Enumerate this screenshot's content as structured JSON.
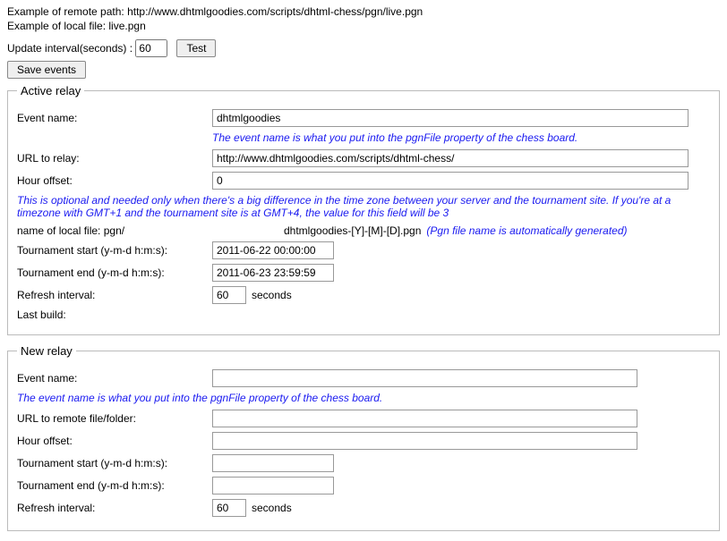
{
  "top": {
    "example_remote": "Example of remote path: http://www.dhtmlgoodies.com/scripts/dhtml-chess/pgn/live.pgn",
    "example_local": "Example of local file: live.pgn",
    "update_label": "Update interval(seconds) :",
    "update_value": "60",
    "test_button": "Test",
    "save_button": "Save events"
  },
  "active": {
    "legend": "Active relay",
    "event_name_label": "Event name:",
    "event_name_value": "dhtmlgoodies",
    "event_name_hint": "The event name is what you put into the pgnFile property of the chess board.",
    "url_label": "URL to relay:",
    "url_value": "http://www.dhtmlgoodies.com/scripts/dhtml-chess/",
    "hour_offset_label": "Hour offset:",
    "hour_offset_value": "0",
    "hour_offset_hint": "This is optional and needed only when there's a big difference in the time zone between your server and the tournament site. If you're at a timezone with GMT+1 and the tournament site is at GMT+4, the value for this field will be 3",
    "local_file_label": "name of local file: pgn/",
    "local_file_value": "dhtmlgoodies-[Y]-[M]-[D].pgn",
    "local_file_hint": "(Pgn file name is automatically generated)",
    "tstart_label": "Tournament start (y-m-d h:m:s):",
    "tstart_value": "2011-06-22 00:00:00",
    "tend_label": "Tournament end (y-m-d h:m:s):",
    "tend_value": "2011-06-23 23:59:59",
    "refresh_label": "Refresh interval:",
    "refresh_value": "60",
    "refresh_unit": "seconds",
    "last_build_label": "Last build:"
  },
  "newrelay": {
    "legend": "New relay",
    "event_name_label": "Event name:",
    "event_name_value": "",
    "event_name_hint": "The event name is what you put into the pgnFile property of the chess board.",
    "url_label": "URL to remote file/folder:",
    "url_value": "",
    "hour_offset_label": "Hour offset:",
    "hour_offset_value": "",
    "tstart_label": "Tournament start (y-m-d h:m:s):",
    "tstart_value": "",
    "tend_label": "Tournament end (y-m-d h:m:s):",
    "tend_value": "",
    "refresh_label": "Refresh interval:",
    "refresh_value": "60",
    "refresh_unit": "seconds"
  }
}
